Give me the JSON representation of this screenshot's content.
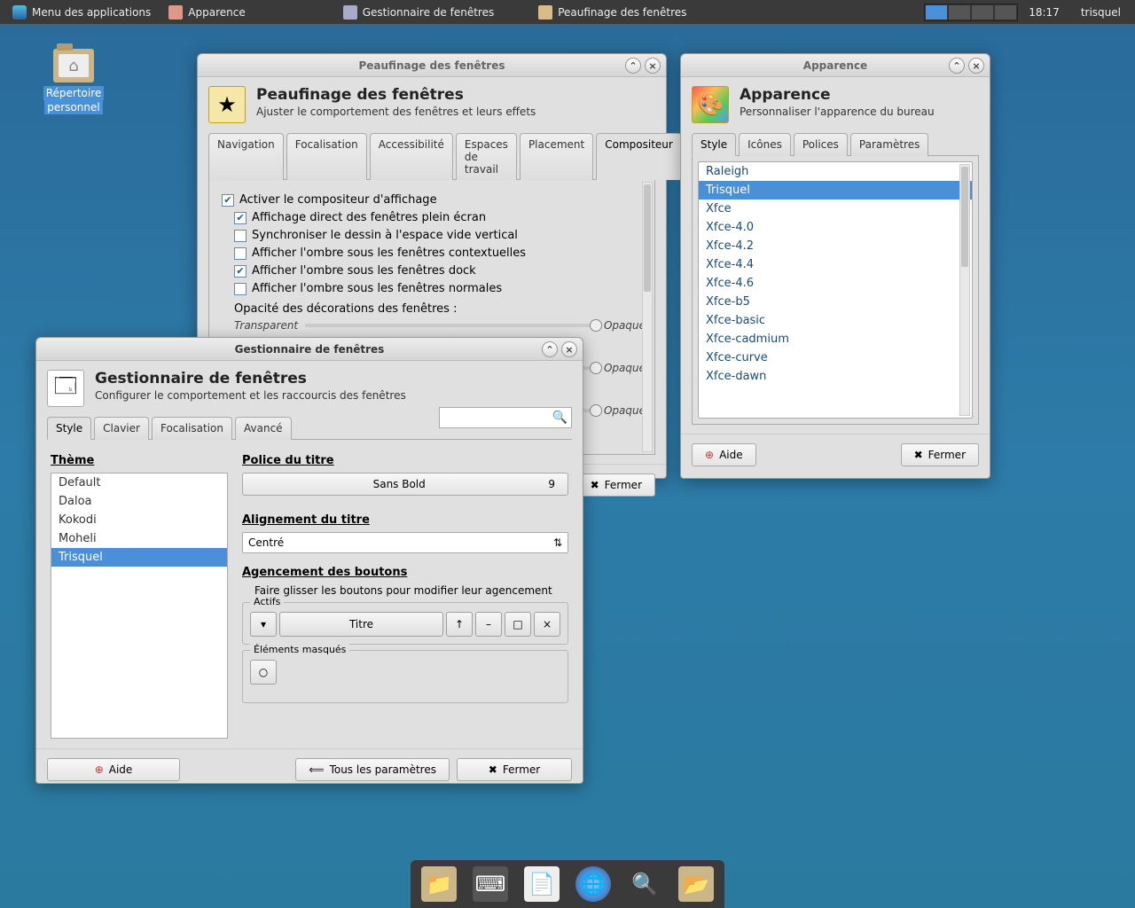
{
  "panel": {
    "app_menu": "Menu des applications",
    "tasks": [
      "Apparence",
      "Gestionnaire de fenêtres",
      "Peaufinage des fenêtres"
    ],
    "clock": "18:17",
    "user": "trisquel"
  },
  "desktop": {
    "home_label_1": "Répertoire",
    "home_label_2": "personnel"
  },
  "tweaks": {
    "title": "Peaufinage des fenêtres",
    "heading": "Peaufinage des fenêtres",
    "sub": "Ajuster le comportement des fenêtres et leurs effets",
    "tabs": [
      "Navigation",
      "Focalisation",
      "Accessibilité",
      "Espaces de travail",
      "Placement",
      "Compositeur"
    ],
    "activate": "Activer le compositeur d'affichage",
    "fullscreen": "Affichage direct des fenêtres plein écran",
    "sync": "Synchroniser le dessin à l'espace vide vertical",
    "shadow_popup": "Afficher l'ombre sous les fenêtres contextuelles",
    "shadow_dock": "Afficher l'ombre sous les fenêtres dock",
    "shadow_normal": "Afficher l'ombre sous les fenêtres normales",
    "opacity_decor": "Opacité des décorations des fenêtres :",
    "transparent": "Transparent",
    "opaque": "Opaque",
    "close": "Fermer"
  },
  "appearance": {
    "title": "Apparence",
    "heading": "Apparence",
    "sub": "Personnaliser l'apparence du bureau",
    "tabs": [
      "Style",
      "Icônes",
      "Polices",
      "Paramètres"
    ],
    "themes": [
      "Raleigh",
      "Trisquel",
      "Xfce",
      "Xfce-4.0",
      "Xfce-4.2",
      "Xfce-4.4",
      "Xfce-4.6",
      "Xfce-b5",
      "Xfce-basic",
      "Xfce-cadmium",
      "Xfce-curve",
      "Xfce-dawn"
    ],
    "selected_index": 1,
    "help": "Aide",
    "close": "Fermer"
  },
  "wm": {
    "title": "Gestionnaire de fenêtres",
    "heading": "Gestionnaire de fenêtres",
    "sub": "Configurer le comportement et les raccourcis des fenêtres",
    "tabs": [
      "Style",
      "Clavier",
      "Focalisation",
      "Avancé"
    ],
    "theme_label": "Thème",
    "themes": [
      "Default",
      "Daloa",
      "Kokodi",
      "Moheli",
      "Trisquel"
    ],
    "theme_selected_index": 4,
    "font_label": "Police du titre",
    "font_name": "Sans Bold",
    "font_size": "9",
    "align_label": "Alignement du titre",
    "align_value": "Centré",
    "layout_label": "Agencement des boutons",
    "layout_hint": "Faire glisser les boutons pour modifier leur agencement",
    "active_label": "Actifs",
    "titre": "Titre",
    "hidden_label": "Éléments masqués",
    "help": "Aide",
    "all_settings": "Tous les paramètres",
    "close": "Fermer"
  }
}
